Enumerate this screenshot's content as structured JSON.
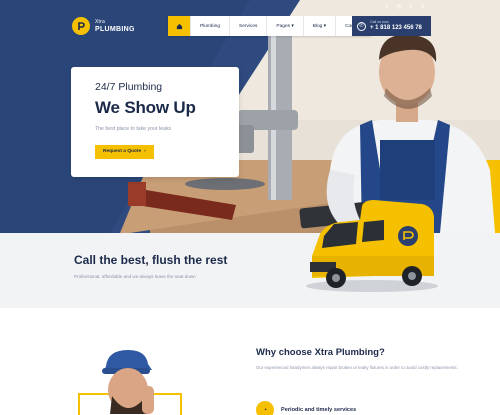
{
  "header": {
    "logo": {
      "line1": "Xtra",
      "line2": "PLUMBING"
    },
    "social_icons": [
      "facebook-icon",
      "instagram-icon",
      "twitter-icon",
      "vimeo-icon"
    ],
    "nav": {
      "home_icon": "home-icon",
      "items": [
        "Plumbing",
        "Services",
        "Pages ▾",
        "Blog ▾",
        "Contact"
      ]
    },
    "call": {
      "label": "Call us now",
      "phone": "+ 1 818 123 456 78"
    }
  },
  "hero": {
    "subtitle": "24/7 Plumbing",
    "title": "We Show Up",
    "description": "The best place to take your leaks",
    "button_label": "Request a Quote"
  },
  "call_section": {
    "title": "Call the best, flush the rest",
    "text": "Professional, affordable and we always leave the seat down"
  },
  "why": {
    "title": "Why choose Xtra Plumbing?",
    "text": "Our experienced handymen always repair broken or leaky fixtures in order to avoid costly replacements.",
    "feature_label": "Periodic and timely services"
  },
  "colors": {
    "accent": "#f5c000",
    "navy": "#2a3f6d",
    "text": "#1c2a4a"
  }
}
